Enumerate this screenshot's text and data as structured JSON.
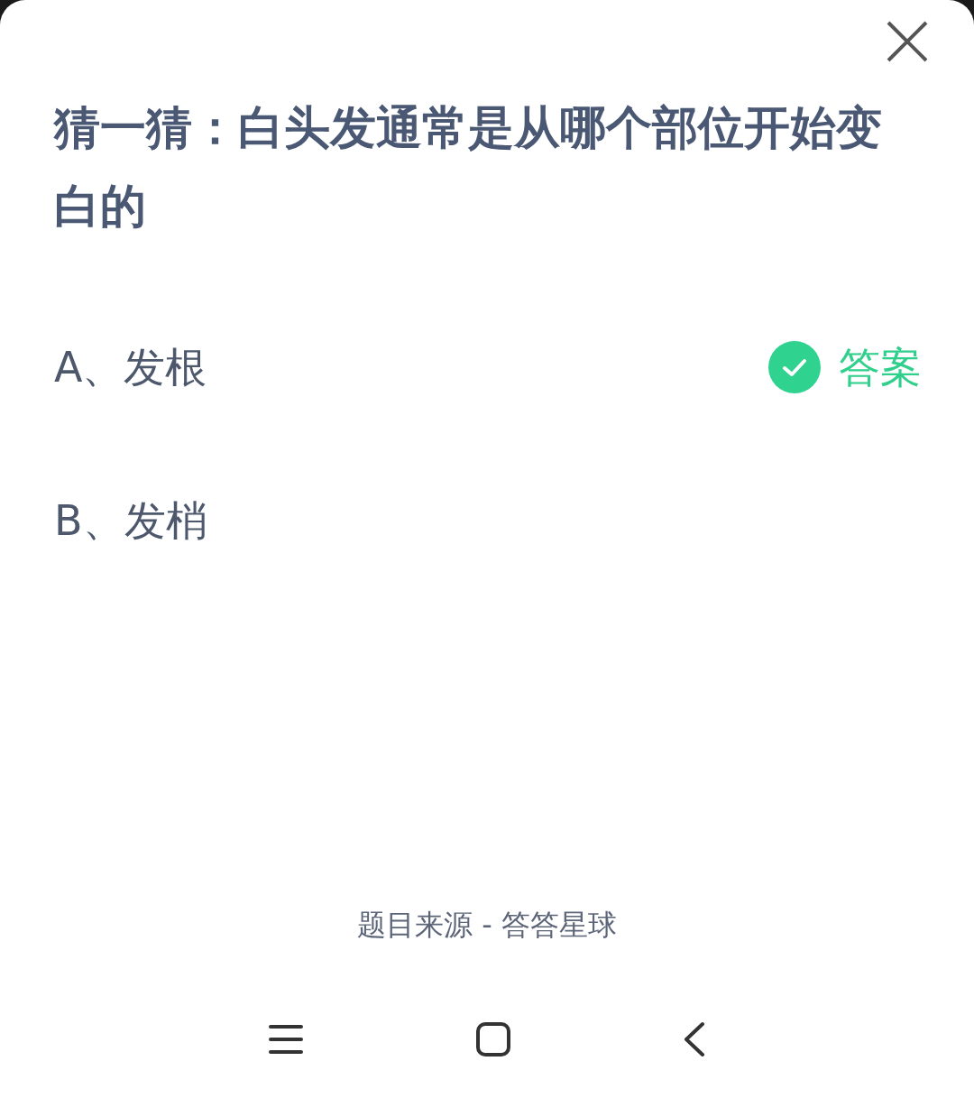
{
  "title": "猜一猜：白头发通常是从哪个部位开始变白的",
  "options": [
    {
      "label": "A、发根",
      "correct": true,
      "answer_label": "答案"
    },
    {
      "label": "B、发梢",
      "correct": false
    }
  ],
  "source": "题目来源 - 答答星球"
}
